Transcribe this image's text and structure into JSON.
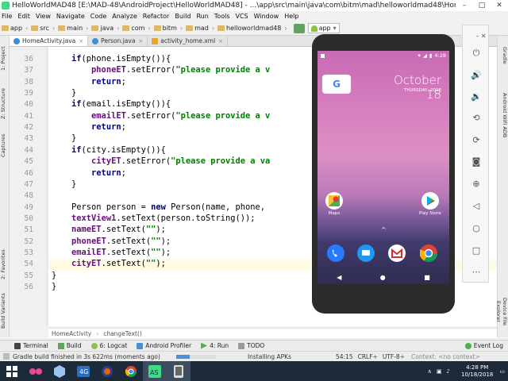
{
  "window": {
    "title": "HelloWorldMAD48 [E:\\MAD-48\\AndroidProject\\HelloWorldMAD48] - ...\\app\\src\\main\\java\\com\\bitm\\mad\\helloworldmad48\\Home...",
    "controls": [
      "–",
      "□",
      "✕"
    ]
  },
  "menu": [
    "File",
    "Edit",
    "View",
    "Navigate",
    "Code",
    "Analyze",
    "Refactor",
    "Build",
    "Run",
    "Tools",
    "VCS",
    "Window",
    "Help"
  ],
  "toolbar": {
    "breadcrumbs": [
      "app",
      "src",
      "main",
      "java",
      "com",
      "bitm",
      "mad",
      "helloworldmad48"
    ],
    "run_config": "app"
  },
  "left_tabs": [
    "1: Project",
    "Z: Structure",
    "Captures",
    "2: Favorites",
    "Build Variants"
  ],
  "right_tabs": [
    "Gradle",
    "Android WiFi ADB",
    "Device File Explorer"
  ],
  "editor_tabs": [
    {
      "label": "HomeActivity.java",
      "active": true,
      "color": "#3d8fd6"
    },
    {
      "label": "Person.java",
      "active": false,
      "color": "#3d8fd6"
    },
    {
      "label": "activity_home.xml",
      "active": false,
      "color": "#e8a530"
    }
  ],
  "code_lines": [
    {
      "n": "36",
      "t": "    if(phone.isEmpty()){"
    },
    {
      "n": "37",
      "t": "        phoneET.setError(\"please provide a v"
    },
    {
      "n": "38",
      "t": "        return;"
    },
    {
      "n": "39",
      "t": "    }"
    },
    {
      "n": "40",
      "t": "    if(email.isEmpty()){"
    },
    {
      "n": "41",
      "t": "        emailET.setError(\"please provide a v"
    },
    {
      "n": "42",
      "t": "        return;"
    },
    {
      "n": "43",
      "t": "    }"
    },
    {
      "n": "44",
      "t": "    if(city.isEmpty()){"
    },
    {
      "n": "45",
      "t": "        cityET.setError(\"please provide a va"
    },
    {
      "n": "46",
      "t": "        return;"
    },
    {
      "n": "47",
      "t": "    }"
    },
    {
      "n": "48",
      "t": ""
    },
    {
      "n": "49",
      "t": "    Person person = new Person(name, phone,"
    },
    {
      "n": "50",
      "t": "    textView1.setText(person.toString());"
    },
    {
      "n": "51",
      "t": "    nameET.setText(\"\");"
    },
    {
      "n": "52",
      "t": "    phoneET.setText(\"\");"
    },
    {
      "n": "53",
      "t": "    emailET.setText(\"\");"
    },
    {
      "n": "54",
      "t": "    cityET.setText(\"\");"
    },
    {
      "n": "55",
      "t": "}"
    },
    {
      "n": "56",
      "t": "}"
    }
  ],
  "editor_breadcrumb": [
    "HomeActivity",
    "changeText()"
  ],
  "bottom_tabs": [
    "Terminal",
    "Build",
    "6: Logcat",
    "Android Profiler",
    "4: Run",
    "TODO"
  ],
  "event_log": "Event Log",
  "status": {
    "message": "Gradle build finished in 3s 622ms (moments ago)",
    "task": "Installing APKs",
    "progress": 0.35,
    "position": "54:15",
    "line_sep": "CRLF÷",
    "encoding": "UTF-8÷",
    "context": "Context: <no context>"
  },
  "emulator": {
    "time": "4:28",
    "date": "October 18",
    "day": "THURSDAY, 2018",
    "apps_top": [
      {
        "label": "Maps"
      },
      {
        "label": "Play Store"
      }
    ],
    "dock": [
      "phone",
      "messages",
      "gmail",
      "chrome"
    ]
  },
  "taskbar": {
    "time": "4:28 PM",
    "date": "10/18/2018",
    "icons": [
      "windows",
      "cortana",
      "virtualbox",
      "4g",
      "firefox",
      "chrome",
      "android-studio",
      "emulator"
    ]
  },
  "colors": {
    "accent": "#3d8fd6",
    "taskbar": "#1c2a3a"
  }
}
